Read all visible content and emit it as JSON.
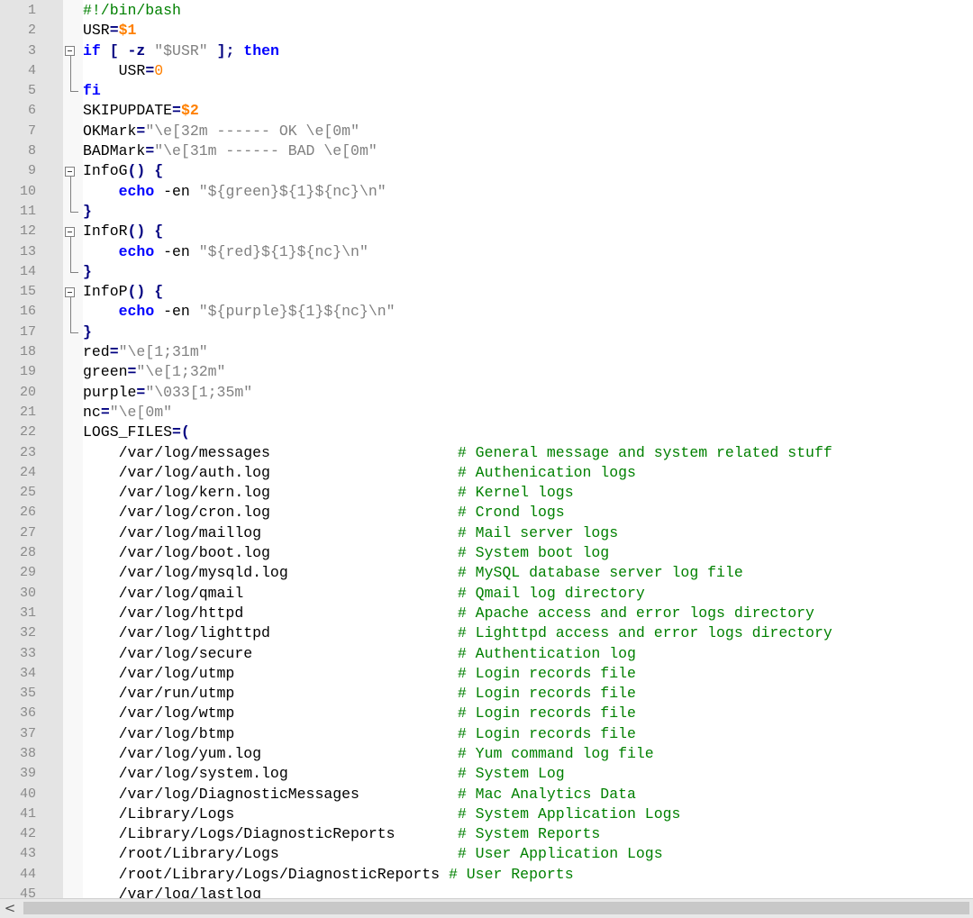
{
  "editor": {
    "language": "bash",
    "colors": {
      "keyword": "#0000ff",
      "string": "#808080",
      "number": "#ff8000",
      "comment": "#008000",
      "line_number": "#8a8a8a"
    },
    "lines": [
      {
        "n": "1",
        "parts": [
          {
            "t": "#!/bin/bash",
            "c": "cmt"
          }
        ]
      },
      {
        "n": "2",
        "parts": [
          {
            "t": "USR"
          },
          {
            "t": "=",
            "c": "op"
          },
          {
            "t": "$1",
            "c": "var"
          }
        ]
      },
      {
        "n": "3",
        "parts": [
          {
            "t": "if",
            "c": "kw"
          },
          {
            "t": " "
          },
          {
            "t": "[",
            "c": "op"
          },
          {
            "t": " "
          },
          {
            "t": "-z",
            "c": "op"
          },
          {
            "t": " "
          },
          {
            "t": "\"$USR\"",
            "c": "str"
          },
          {
            "t": " "
          },
          {
            "t": "];",
            "c": "op"
          },
          {
            "t": " "
          },
          {
            "t": "then",
            "c": "kw"
          }
        ]
      },
      {
        "n": "4",
        "parts": [
          {
            "t": "    USR"
          },
          {
            "t": "=",
            "c": "op"
          },
          {
            "t": "0",
            "c": "num"
          }
        ]
      },
      {
        "n": "5",
        "parts": [
          {
            "t": "fi",
            "c": "kw"
          }
        ]
      },
      {
        "n": "6",
        "parts": [
          {
            "t": "SKIPUPDATE"
          },
          {
            "t": "=",
            "c": "op"
          },
          {
            "t": "$2",
            "c": "var"
          }
        ]
      },
      {
        "n": "7",
        "parts": [
          {
            "t": "OKMark"
          },
          {
            "t": "=",
            "c": "op"
          },
          {
            "t": "\"\\e[32m ------ OK \\e[0m\"",
            "c": "str"
          }
        ]
      },
      {
        "n": "8",
        "parts": [
          {
            "t": "BADMark"
          },
          {
            "t": "=",
            "c": "op"
          },
          {
            "t": "\"\\e[31m ------ BAD \\e[0m\"",
            "c": "str"
          }
        ]
      },
      {
        "n": "9",
        "parts": [
          {
            "t": "InfoG"
          },
          {
            "t": "()",
            "c": "op"
          },
          {
            "t": " "
          },
          {
            "t": "{",
            "c": "op"
          }
        ]
      },
      {
        "n": "10",
        "parts": [
          {
            "t": "    "
          },
          {
            "t": "echo",
            "c": "kw"
          },
          {
            "t": " -en "
          },
          {
            "t": "\"${green}${1}${nc}\\n\"",
            "c": "str"
          }
        ]
      },
      {
        "n": "11",
        "parts": [
          {
            "t": "}",
            "c": "op"
          }
        ]
      },
      {
        "n": "12",
        "parts": [
          {
            "t": "InfoR"
          },
          {
            "t": "()",
            "c": "op"
          },
          {
            "t": " "
          },
          {
            "t": "{",
            "c": "op"
          }
        ]
      },
      {
        "n": "13",
        "parts": [
          {
            "t": "    "
          },
          {
            "t": "echo",
            "c": "kw"
          },
          {
            "t": " -en "
          },
          {
            "t": "\"${red}${1}${nc}\\n\"",
            "c": "str"
          }
        ]
      },
      {
        "n": "14",
        "parts": [
          {
            "t": "}",
            "c": "op"
          }
        ]
      },
      {
        "n": "15",
        "parts": [
          {
            "t": "InfoP"
          },
          {
            "t": "()",
            "c": "op"
          },
          {
            "t": " "
          },
          {
            "t": "{",
            "c": "op"
          }
        ]
      },
      {
        "n": "16",
        "parts": [
          {
            "t": "    "
          },
          {
            "t": "echo",
            "c": "kw"
          },
          {
            "t": " -en "
          },
          {
            "t": "\"${purple}${1}${nc}\\n\"",
            "c": "str"
          }
        ]
      },
      {
        "n": "17",
        "parts": [
          {
            "t": "}",
            "c": "op"
          }
        ]
      },
      {
        "n": "18",
        "parts": [
          {
            "t": "red"
          },
          {
            "t": "=",
            "c": "op"
          },
          {
            "t": "\"\\e[1;31m\"",
            "c": "str"
          }
        ]
      },
      {
        "n": "19",
        "parts": [
          {
            "t": "green"
          },
          {
            "t": "=",
            "c": "op"
          },
          {
            "t": "\"\\e[1;32m\"",
            "c": "str"
          }
        ]
      },
      {
        "n": "20",
        "parts": [
          {
            "t": "purple"
          },
          {
            "t": "=",
            "c": "op"
          },
          {
            "t": "\"\\033[1;35m\"",
            "c": "str"
          }
        ]
      },
      {
        "n": "21",
        "parts": [
          {
            "t": "nc"
          },
          {
            "t": "=",
            "c": "op"
          },
          {
            "t": "\"\\e[0m\"",
            "c": "str"
          }
        ]
      },
      {
        "n": "22",
        "parts": [
          {
            "t": "LOGS_FILES"
          },
          {
            "t": "=(",
            "c": "op"
          }
        ]
      },
      {
        "n": "23",
        "parts": [
          {
            "t": "    /var/log/messages                     "
          },
          {
            "t": "# General message and system related stuff",
            "c": "cmt"
          }
        ]
      },
      {
        "n": "24",
        "parts": [
          {
            "t": "    /var/log/auth.log                     "
          },
          {
            "t": "# Authenication logs",
            "c": "cmt"
          }
        ]
      },
      {
        "n": "25",
        "parts": [
          {
            "t": "    /var/log/kern.log                     "
          },
          {
            "t": "# Kernel logs",
            "c": "cmt"
          }
        ]
      },
      {
        "n": "26",
        "parts": [
          {
            "t": "    /var/log/cron.log                     "
          },
          {
            "t": "# Crond logs",
            "c": "cmt"
          }
        ]
      },
      {
        "n": "27",
        "parts": [
          {
            "t": "    /var/log/maillog                      "
          },
          {
            "t": "# Mail server logs",
            "c": "cmt"
          }
        ]
      },
      {
        "n": "28",
        "parts": [
          {
            "t": "    /var/log/boot.log                     "
          },
          {
            "t": "# System boot log",
            "c": "cmt"
          }
        ]
      },
      {
        "n": "29",
        "parts": [
          {
            "t": "    /var/log/mysqld.log                   "
          },
          {
            "t": "# MySQL database server log file",
            "c": "cmt"
          }
        ]
      },
      {
        "n": "30",
        "parts": [
          {
            "t": "    /var/log/qmail                        "
          },
          {
            "t": "# Qmail log directory",
            "c": "cmt"
          }
        ]
      },
      {
        "n": "31",
        "parts": [
          {
            "t": "    /var/log/httpd                        "
          },
          {
            "t": "# Apache access and error logs directory",
            "c": "cmt"
          }
        ]
      },
      {
        "n": "32",
        "parts": [
          {
            "t": "    /var/log/lighttpd                     "
          },
          {
            "t": "# Lighttpd access and error logs directory",
            "c": "cmt"
          }
        ]
      },
      {
        "n": "33",
        "parts": [
          {
            "t": "    /var/log/secure                       "
          },
          {
            "t": "# Authentication log",
            "c": "cmt"
          }
        ]
      },
      {
        "n": "34",
        "parts": [
          {
            "t": "    /var/log/utmp                         "
          },
          {
            "t": "# Login records file",
            "c": "cmt"
          }
        ]
      },
      {
        "n": "35",
        "parts": [
          {
            "t": "    /var/run/utmp                         "
          },
          {
            "t": "# Login records file",
            "c": "cmt"
          }
        ]
      },
      {
        "n": "36",
        "parts": [
          {
            "t": "    /var/log/wtmp                         "
          },
          {
            "t": "# Login records file",
            "c": "cmt"
          }
        ]
      },
      {
        "n": "37",
        "parts": [
          {
            "t": "    /var/log/btmp                         "
          },
          {
            "t": "# Login records file",
            "c": "cmt"
          }
        ]
      },
      {
        "n": "38",
        "parts": [
          {
            "t": "    /var/log/yum.log                      "
          },
          {
            "t": "# Yum command log file",
            "c": "cmt"
          }
        ]
      },
      {
        "n": "39",
        "parts": [
          {
            "t": "    /var/log/system.log                   "
          },
          {
            "t": "# System Log",
            "c": "cmt"
          }
        ]
      },
      {
        "n": "40",
        "parts": [
          {
            "t": "    /var/log/DiagnosticMessages           "
          },
          {
            "t": "# Mac Analytics Data",
            "c": "cmt"
          }
        ]
      },
      {
        "n": "41",
        "parts": [
          {
            "t": "    /Library/Logs                         "
          },
          {
            "t": "# System Application Logs",
            "c": "cmt"
          }
        ]
      },
      {
        "n": "42",
        "parts": [
          {
            "t": "    /Library/Logs/DiagnosticReports       "
          },
          {
            "t": "# System Reports",
            "c": "cmt"
          }
        ]
      },
      {
        "n": "43",
        "parts": [
          {
            "t": "    /root/Library/Logs                    "
          },
          {
            "t": "# User Application Logs",
            "c": "cmt"
          }
        ]
      },
      {
        "n": "44",
        "parts": [
          {
            "t": "    /root/Library/Logs/DiagnosticReports "
          },
          {
            "t": "# User Reports",
            "c": "cmt"
          }
        ]
      },
      {
        "n": "45",
        "parts": [
          {
            "t": "    /var/log/lastlog"
          }
        ]
      }
    ]
  },
  "scrollbar": {
    "left_arrow": "<"
  }
}
